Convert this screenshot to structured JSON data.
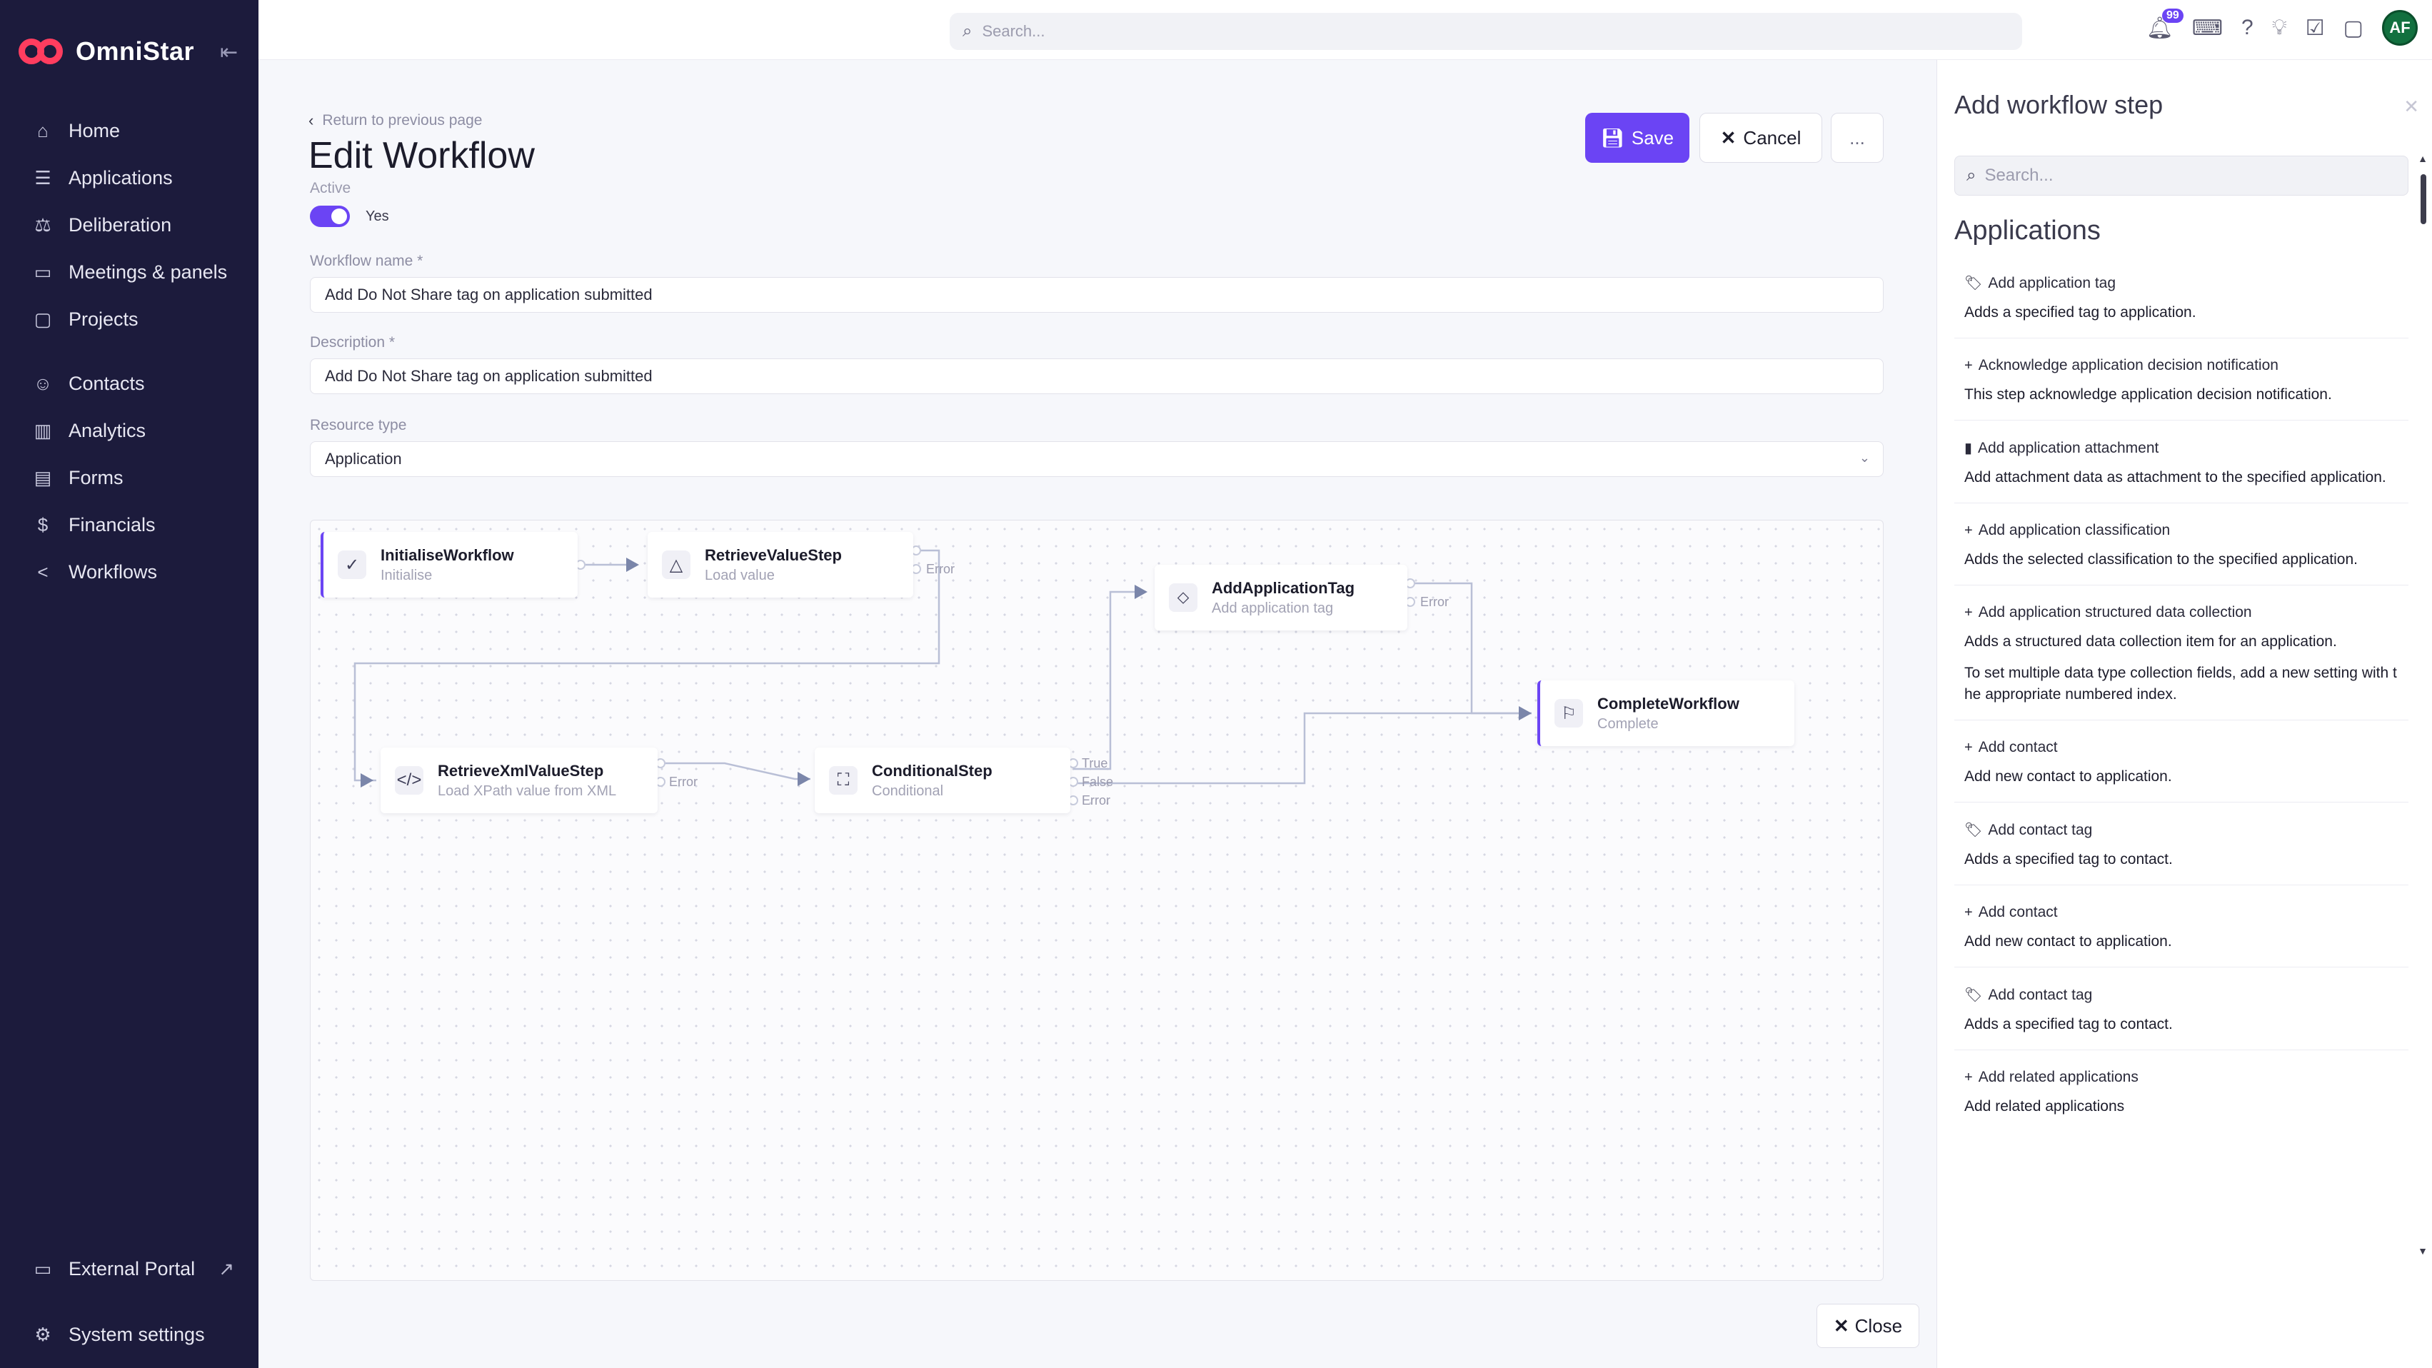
{
  "app": {
    "name": "OmniStar"
  },
  "sidebar": {
    "items": [
      {
        "label": "Home",
        "icon": "home-icon"
      },
      {
        "label": "Applications",
        "icon": "list-icon"
      },
      {
        "label": "Deliberation",
        "icon": "gavel-icon"
      },
      {
        "label": "Meetings & panels",
        "icon": "calendar-icon"
      },
      {
        "label": "Projects",
        "icon": "monitor-icon"
      },
      {
        "label": "Contacts",
        "icon": "contacts-icon"
      },
      {
        "label": "Analytics",
        "icon": "analytics-icon"
      },
      {
        "label": "Forms",
        "icon": "forms-icon"
      },
      {
        "label": "Financials",
        "icon": "dollar-icon"
      },
      {
        "label": "Workflows",
        "icon": "share-icon"
      }
    ],
    "external_portal": "External Portal",
    "system_settings": "System settings"
  },
  "topbar": {
    "search_placeholder": "Search...",
    "notification_count": "99",
    "avatar_initials": "AF"
  },
  "main": {
    "back_link": "Return to previous page",
    "title": "Edit Workflow",
    "active_label": "Active",
    "active_value": "Yes",
    "save_label": "Save",
    "cancel_label": "Cancel",
    "more_label": "...",
    "workflow_name_label": "Workflow name *",
    "workflow_name_value": "Add Do Not Share tag on application submitted",
    "description_label": "Description *",
    "description_value": "Add Do Not Share tag on application submitted",
    "resource_type_label": "Resource type",
    "resource_type_value": "Application"
  },
  "workflow": {
    "nodes": [
      {
        "title": "InitialiseWorkflow",
        "sub": "Initialise",
        "icon": "check-icon"
      },
      {
        "title": "RetrieveValueStep",
        "sub": "Load value",
        "icon": "triangle-icon"
      },
      {
        "title": "AddApplicationTag",
        "sub": "Add application tag",
        "icon": "tag-icon"
      },
      {
        "title": "CompleteWorkflow",
        "sub": "Complete",
        "icon": "flag-icon"
      },
      {
        "title": "RetrieveXmlValueStep",
        "sub": "Load XPath value from XML",
        "icon": "code-icon"
      },
      {
        "title": "ConditionalStep",
        "sub": "Conditional",
        "icon": "conditional-icon"
      }
    ],
    "port_labels": {
      "error": "Error",
      "true": "True",
      "false": "False"
    }
  },
  "panel": {
    "title": "Add workflow step",
    "search_placeholder": "Search...",
    "section": "Applications",
    "close_label": "Close",
    "steps": [
      {
        "icon": "tag-icon",
        "title": "Add application tag",
        "desc": "Adds a specified tag to application."
      },
      {
        "icon": "plus-icon",
        "title": "Acknowledge application decision notification",
        "desc": "This step acknowledge application decision notification."
      },
      {
        "icon": "file-icon",
        "title": "Add application attachment",
        "desc": "Add attachment data as attachment to the specified application."
      },
      {
        "icon": "plus-icon",
        "title": "Add application classification",
        "desc": "Adds the selected classification to the specified application."
      },
      {
        "icon": "plus-icon",
        "title": "Add application structured data collection",
        "desc": "Adds a structured data collection item for an application.",
        "desc2": "To set multiple data type collection fields, add a new setting with the appropriate numbered index."
      },
      {
        "icon": "plus-icon",
        "title": "Add contact",
        "desc": "Add new contact to application."
      },
      {
        "icon": "tag-icon",
        "title": "Add contact tag",
        "desc": "Adds a specified tag to contact."
      },
      {
        "icon": "plus-icon",
        "title": "Add contact",
        "desc": "Add new contact to application."
      },
      {
        "icon": "tag-icon",
        "title": "Add contact tag",
        "desc": "Adds a specified tag to contact."
      },
      {
        "icon": "plus-icon",
        "title": "Add related applications",
        "desc": "Add related applications"
      }
    ]
  }
}
